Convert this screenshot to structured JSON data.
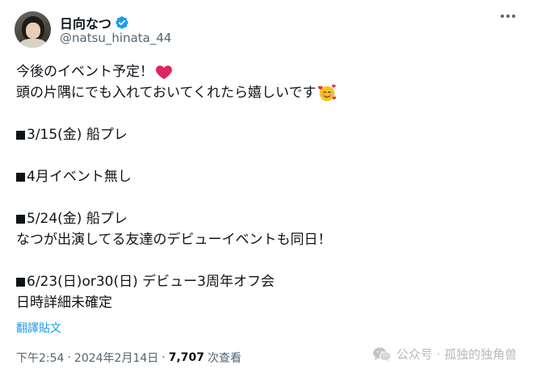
{
  "author": {
    "display_name": "日向なつ",
    "handle": "@natsu_hinata_44"
  },
  "tweet": {
    "lines": [
      "今後のイベント予定！",
      "頭の片隅にでも入れておいてくれたら嬉しいです",
      "",
      "3/15(金) 船プレ",
      "",
      "4月イベント無し",
      "",
      "5/24(金) 船プレ",
      "なつが出演してる友達のデビューイベントも同日！",
      "",
      "6/23(日)or30(日) デビュー3周年オフ会",
      "日時詳細未確定"
    ]
  },
  "translate_label": "翻譯貼文",
  "meta": {
    "time": "下午2:54",
    "separator": "·",
    "date": "2024年2月14日",
    "views_count": "7,707",
    "views_label": "次查看"
  },
  "watermark": {
    "text": "公众号 · 孤独的独角兽"
  },
  "colors": {
    "accent": "#1d9bf0",
    "secondary_text": "#536471",
    "heart": "#e0245e"
  },
  "icons": [
    "verified-badge-icon",
    "more-options-icon",
    "heart-emoji-icon",
    "smiling-face-with-hearts-icon",
    "black-square-icon",
    "wechat-icon"
  ]
}
